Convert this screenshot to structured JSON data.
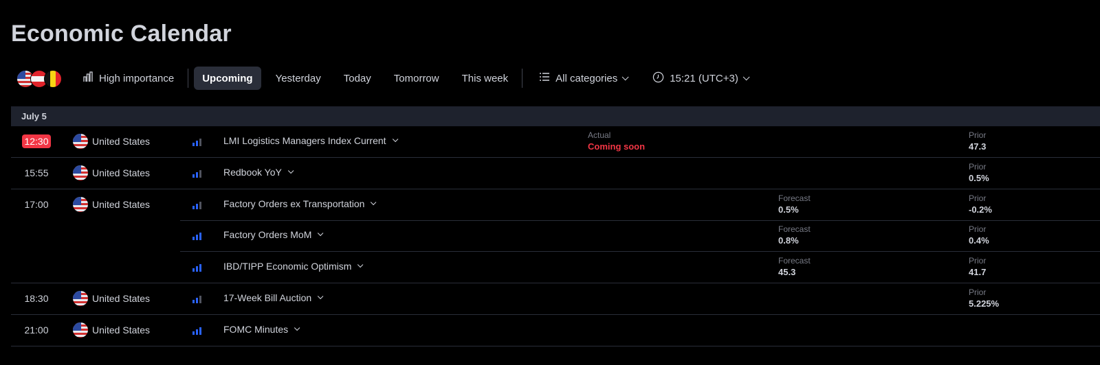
{
  "page": {
    "title": "Economic Calendar"
  },
  "toolbar": {
    "high_importance": "High importance",
    "tabs": [
      "Upcoming",
      "Yesterday",
      "Today",
      "Tomorrow",
      "This week"
    ],
    "active_tab": "Upcoming",
    "categories": "All categories",
    "timezone": "15:21 (UTC+3)"
  },
  "colors": {
    "accent_red": "#f23645",
    "importance_blue": "#2962ff",
    "date_row_bg": "#1e222d"
  },
  "date_header": "July 5",
  "labels": {
    "actual": "Actual",
    "forecast": "Forecast",
    "prior": "Prior"
  },
  "events": [
    {
      "time": "12:30",
      "highlight": true,
      "country": "United States",
      "importance": 2,
      "name": "LMI Logistics Managers Index Current",
      "actual": "Coming soon",
      "forecast": "",
      "prior": "47.3"
    },
    {
      "time": "15:55",
      "highlight": false,
      "country": "United States",
      "importance": 2,
      "name": "Redbook YoY",
      "actual": "",
      "forecast": "",
      "prior": "0.5%"
    },
    {
      "time": "17:00",
      "highlight": false,
      "country": "United States",
      "importance": 2,
      "name": "Factory Orders ex Transportation",
      "actual": "",
      "forecast": "0.5%",
      "prior": "-0.2%"
    },
    {
      "time": "",
      "highlight": false,
      "country": "",
      "importance": 3,
      "name": "Factory Orders MoM",
      "actual": "",
      "forecast": "0.8%",
      "prior": "0.4%"
    },
    {
      "time": "",
      "highlight": false,
      "country": "",
      "importance": 3,
      "name": "IBD/TIPP Economic Optimism",
      "actual": "",
      "forecast": "45.3",
      "prior": "41.7"
    },
    {
      "time": "18:30",
      "highlight": false,
      "country": "United States",
      "importance": 2,
      "name": "17-Week Bill Auction",
      "actual": "",
      "forecast": "",
      "prior": "5.225%"
    },
    {
      "time": "21:00",
      "highlight": false,
      "country": "United States",
      "importance": 3,
      "name": "FOMC Minutes",
      "actual": "",
      "forecast": "",
      "prior": ""
    }
  ]
}
